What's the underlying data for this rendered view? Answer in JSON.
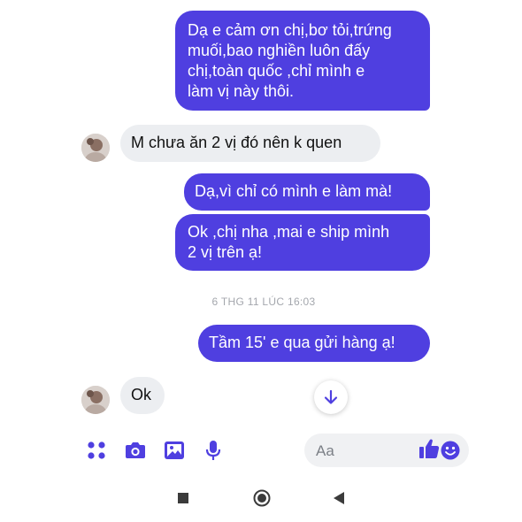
{
  "colors": {
    "outgoing_bubble": "#4f3fe0",
    "incoming_bubble": "#eceef1",
    "accent": "#4f3fe0"
  },
  "conversation": {
    "messages": [
      {
        "direction": "outgoing",
        "text": "Dạ e cảm ơn chị,bơ tỏi,trứng\nmuối,bao nghiền luôn đấy\nchị,toàn quốc ,chỉ mình e\nlàm vị này thôi."
      },
      {
        "direction": "incoming",
        "text": "M chưa ăn 2 vị đó nên k quen"
      },
      {
        "direction": "outgoing",
        "text": "Dạ,vì chỉ có mình e làm mà!"
      },
      {
        "direction": "outgoing",
        "text": "Ok ,chị nha ,mai e ship mình\n2 vị trên ạ!"
      },
      {
        "direction": "outgoing",
        "text": "Tầm 15' e qua gửi hàng ạ!"
      },
      {
        "direction": "incoming",
        "text": "Ok"
      }
    ],
    "timestamp": "6 THG 11 LÚC 16:03"
  },
  "composer": {
    "placeholder": "Aa",
    "icons": [
      "apps-icon",
      "camera-icon",
      "gallery-icon",
      "microphone-icon",
      "emoji-icon",
      "like-icon"
    ]
  },
  "navigation": {
    "icons": [
      "recents-square-icon",
      "home-circle-icon",
      "back-triangle-icon"
    ]
  },
  "scroll_button": {
    "icon": "arrow-down-icon"
  }
}
